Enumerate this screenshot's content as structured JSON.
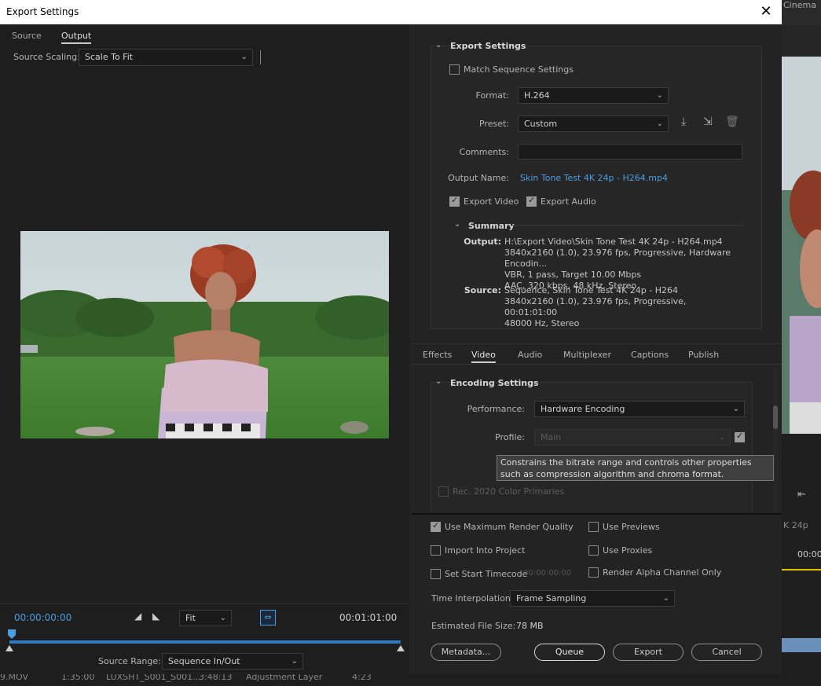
{
  "window": {
    "title": "Export Settings",
    "close_icon": "close-icon"
  },
  "left_tabs": [
    {
      "label": "Source"
    },
    {
      "label": "Output"
    }
  ],
  "source_scaling": {
    "label": "Source Scaling:",
    "value": "Scale To Fit"
  },
  "timeline": {
    "current_time": "00:00:00:00",
    "end_time": "00:01:01:00",
    "zoom": "Fit",
    "source_range_label": "Source Range:",
    "source_range_value": "Sequence In/Out"
  },
  "export_settings": {
    "header": "Export Settings",
    "match_sequence": "Match Sequence Settings",
    "format_label": "Format:",
    "format_value": "H.264",
    "preset_label": "Preset:",
    "preset_value": "Custom",
    "comments_label": "Comments:",
    "output_name_label": "Output Name:",
    "output_name_value": "Skin Tone Test 4K 24p  - H264.mp4",
    "export_video": "Export Video",
    "export_audio": "Export Audio"
  },
  "summary": {
    "header": "Summary",
    "output_label": "Output:",
    "output_lines": [
      "H:\\Export Video\\Skin Tone Test 4K 24p  - H264.mp4",
      "3840x2160 (1.0), 23.976 fps, Progressive, Hardware Encodin...",
      "VBR, 1 pass, Target 10.00 Mbps",
      "AAC, 320 kbps, 48 kHz, Stereo"
    ],
    "source_label": "Source:",
    "source_lines": [
      "Sequence, Skin Tone Test 4K 24p  - H264",
      "3840x2160 (1.0), 23.976 fps, Progressive, 00:01:01:00",
      "48000 Hz, Stereo"
    ]
  },
  "right_tabs": [
    {
      "label": "Effects"
    },
    {
      "label": "Video"
    },
    {
      "label": "Audio"
    },
    {
      "label": "Multiplexer"
    },
    {
      "label": "Captions"
    },
    {
      "label": "Publish"
    }
  ],
  "encoding": {
    "header": "Encoding Settings",
    "performance_label": "Performance:",
    "performance_value": "Hardware Encoding",
    "profile_label": "Profile:",
    "profile_value": "Main",
    "rec2020": "Rec. 2020 Color Primaries",
    "tooltip": "Constrains the bitrate range and controls other properties such as compression algorithm and chroma format."
  },
  "bottom": {
    "use_max_render": "Use Maximum Render Quality",
    "use_previews": "Use Previews",
    "import_into_project": "Import Into Project",
    "use_proxies": "Use Proxies",
    "set_start_timecode": "Set Start Timecode",
    "start_timecode_value": "00:00:00:00",
    "render_alpha": "Render Alpha Channel Only",
    "time_interp_label": "Time Interpolation:",
    "time_interp_value": "Frame Sampling",
    "est_size_label": "Estimated File Size:",
    "est_size_value": "78 MB",
    "metadata_btn": "Metadata...",
    "queue_btn": "Queue",
    "export_btn": "Export",
    "cancel_btn": "Cancel"
  },
  "background": {
    "cinema": "Cinema",
    "row_cells": [
      "9.MOV",
      "1:35:00",
      "LUXSHT_S001_S001...",
      "3:48:13",
      "Adjustment Layer",
      "4:23"
    ],
    "right_24p": "K 24p",
    "right_time": "00:00"
  }
}
